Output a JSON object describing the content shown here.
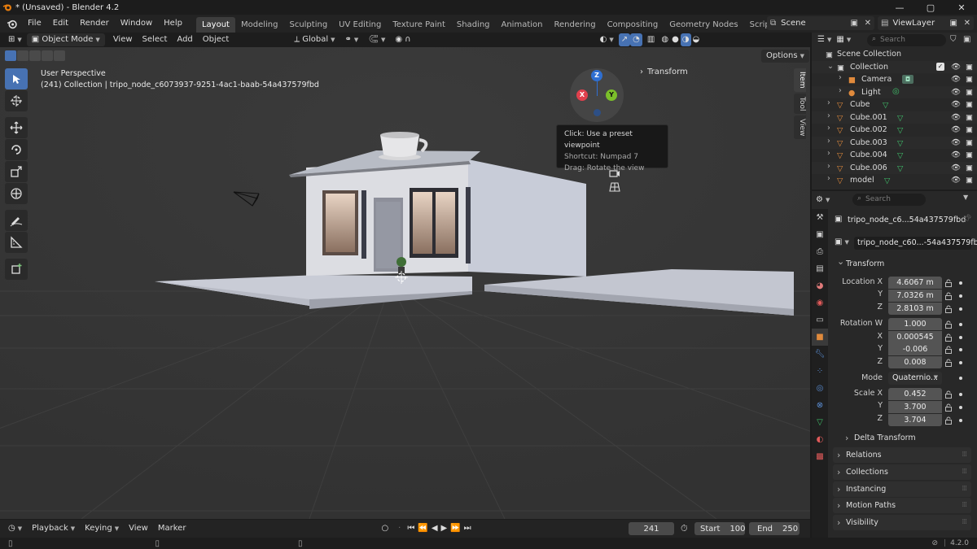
{
  "window": {
    "title": "* (Unsaved) - Blender 4.2"
  },
  "menus": [
    "File",
    "Edit",
    "Render",
    "Window",
    "Help"
  ],
  "workspaces": [
    "Layout",
    "Modeling",
    "Sculpting",
    "UV Editing",
    "Texture Paint",
    "Shading",
    "Animation",
    "Rendering",
    "Compositing",
    "Geometry Nodes",
    "Scripting"
  ],
  "active_workspace": "Layout",
  "scene": {
    "name": "Scene",
    "view_layer": "ViewLayer"
  },
  "viewport_header": {
    "mode": "Object Mode",
    "menus": [
      "View",
      "Select",
      "Add",
      "Object"
    ],
    "orientation": "Global",
    "options_label": "Options"
  },
  "viewport": {
    "perspective": "User Perspective",
    "collection_info": "(241) Collection | tripo_node_c6073937-9251-4ac1-baab-54a437579fbd",
    "transform_header": "Transform",
    "n_tabs": [
      "Item",
      "Tool",
      "View"
    ],
    "gizmo": {
      "x": "X",
      "y": "Y",
      "z": "Z"
    },
    "tooltip": {
      "line1": "Click: Use a preset viewpoint",
      "line2": "Shortcut: Numpad 7",
      "line3": "Drag: Rotate the view"
    }
  },
  "timeline": {
    "menus": [
      "Playback",
      "Keying",
      "View",
      "Marker"
    ],
    "current_frame": "241",
    "start_label": "Start",
    "start": "100",
    "end_label": "End",
    "end": "250"
  },
  "status": {
    "version": "4.2.0"
  },
  "outliner": {
    "search_placeholder": "Search",
    "root": "Scene Collection",
    "items": [
      {
        "name": "Collection",
        "type": "collection"
      },
      {
        "name": "Camera",
        "type": "camera"
      },
      {
        "name": "Light",
        "type": "light"
      },
      {
        "name": "Cube",
        "type": "mesh"
      },
      {
        "name": "Cube.001",
        "type": "mesh"
      },
      {
        "name": "Cube.002",
        "type": "mesh"
      },
      {
        "name": "Cube.003",
        "type": "mesh"
      },
      {
        "name": "Cube.004",
        "type": "mesh"
      },
      {
        "name": "Cube.006",
        "type": "mesh"
      },
      {
        "name": "model",
        "type": "mesh"
      }
    ]
  },
  "properties": {
    "search_placeholder": "Search",
    "object_name": "tripo_node_c6...54a437579fbd",
    "object_field": "tripo_node_c60...-54a437579fbd",
    "transform": {
      "header": "Transform",
      "location_label": "Location X",
      "location": [
        "4.6067 m",
        "7.0326 m",
        "2.8103 m"
      ],
      "rotation_label": "Rotation W",
      "rotation": [
        "1.000",
        "0.000545",
        "-0.006",
        "0.008"
      ],
      "mode_label": "Mode",
      "mode": "Quaternio...",
      "scale_label": "Scale X",
      "scale": [
        "0.452",
        "3.700",
        "3.704"
      ],
      "axis": {
        "x": "X",
        "y": "Y",
        "z": "Z"
      },
      "delta": "Delta Transform"
    },
    "panels": [
      "Relations",
      "Collections",
      "Instancing",
      "Motion Paths",
      "Visibility"
    ]
  },
  "colors": {
    "accent": "#4772b3",
    "mesh_icon": "#3fbf6a",
    "object_icon": "#e08a3c"
  }
}
